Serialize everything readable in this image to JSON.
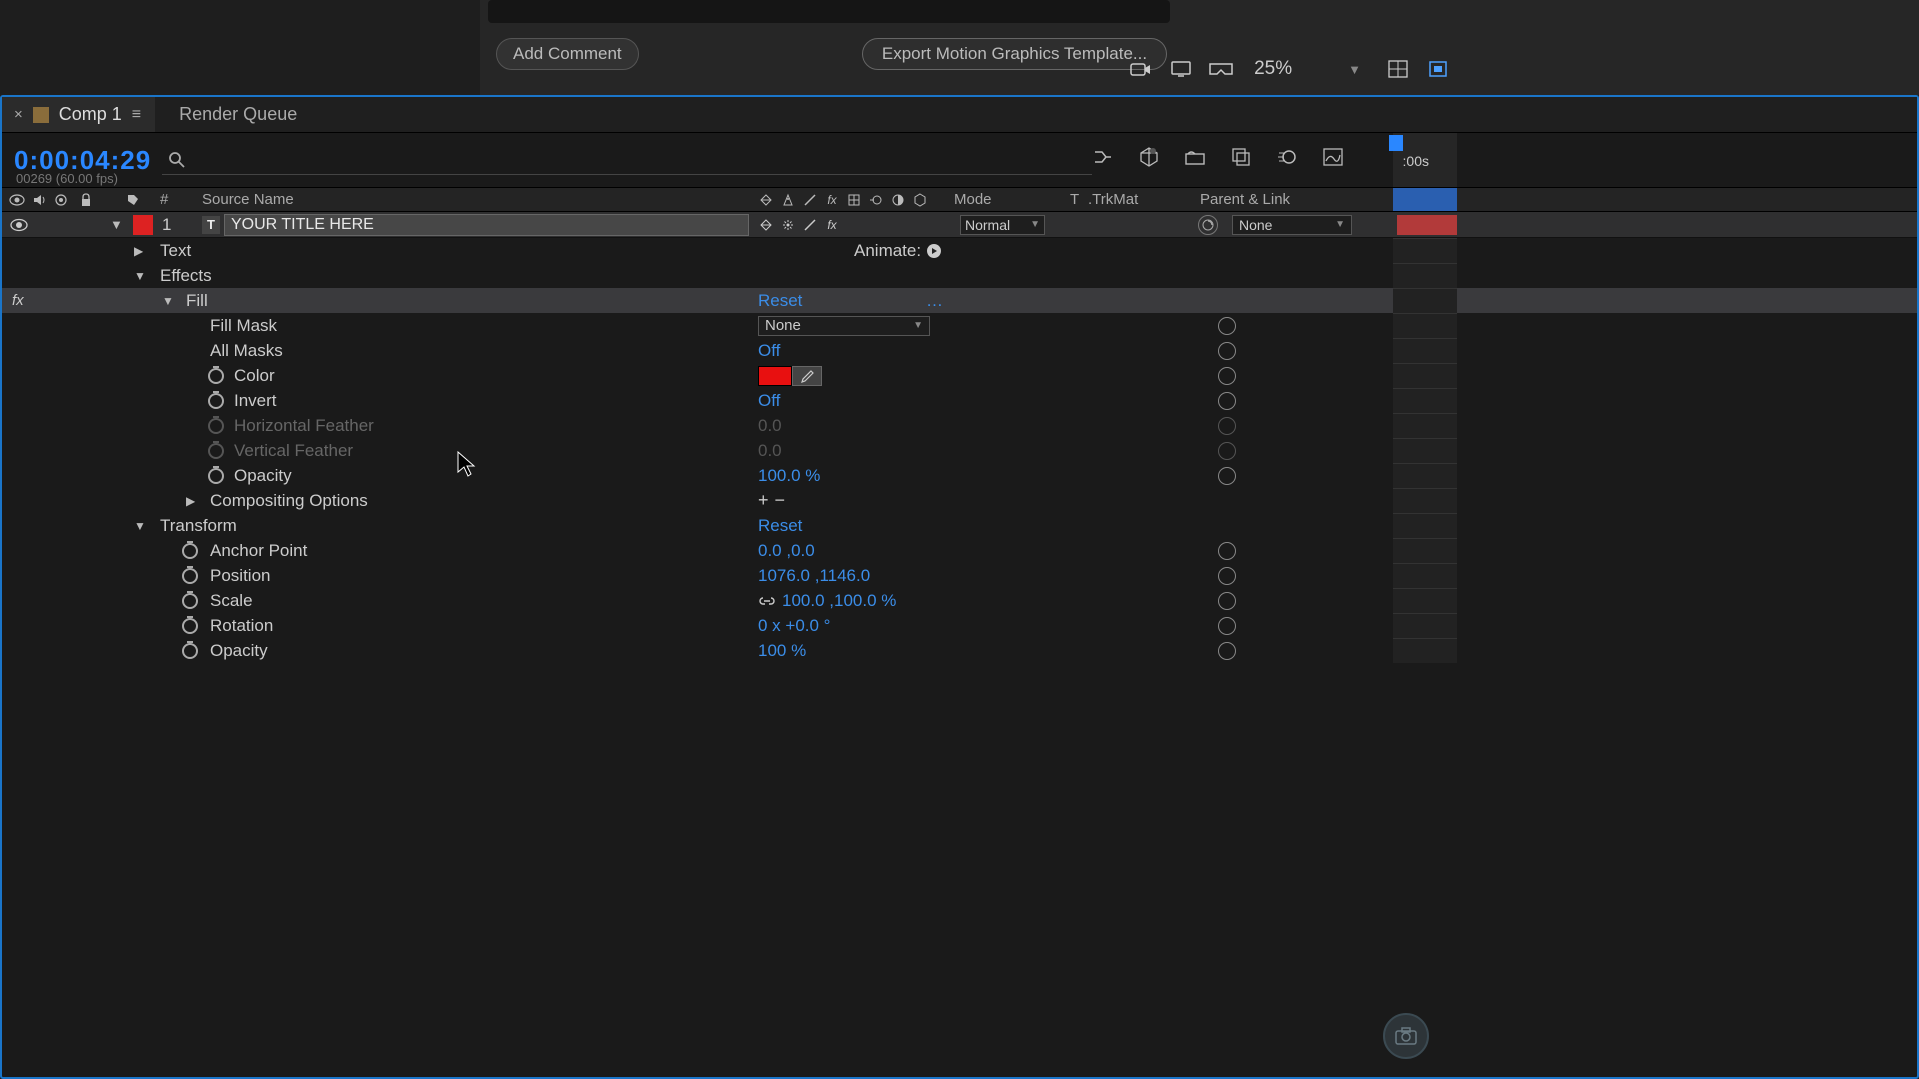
{
  "top": {
    "add_comment": "Add Comment",
    "export_btn": "Export Motion Graphics Template...",
    "zoom": "25%"
  },
  "tabs": {
    "comp_name": "Comp 1",
    "render_queue": "Render Queue"
  },
  "time": {
    "timecode": "0:00:04:29",
    "sub": "00269 (60.00 fps)",
    "ruler_start": ":00s"
  },
  "headers": {
    "num": "#",
    "source": "Source Name",
    "mode": "Mode",
    "t": "T",
    "trkmat": ".TrkMat",
    "parent": "Parent & Link"
  },
  "layer": {
    "index": "1",
    "type_letter": "T",
    "name": "YOUR TITLE HERE",
    "mode": "Normal",
    "parent": "None"
  },
  "text_group": {
    "label": "Text",
    "animate": "Animate:"
  },
  "effects": {
    "label": "Effects",
    "fill": {
      "label": "Fill",
      "reset": "Reset",
      "fill_mask_label": "Fill Mask",
      "fill_mask_value": "None",
      "all_masks_label": "All Masks",
      "all_masks_value": "Off",
      "color_label": "Color",
      "color_value": "#e81010",
      "invert_label": "Invert",
      "invert_value": "Off",
      "hfeather_label": "Horizontal Feather",
      "hfeather_value": "0.0",
      "vfeather_label": "Vertical Feather",
      "vfeather_value": "0.0",
      "opacity_label": "Opacity",
      "opacity_value": "100.0 %",
      "comp_opts_label": "Compositing Options"
    }
  },
  "transform": {
    "label": "Transform",
    "reset": "Reset",
    "anchor_label": "Anchor Point",
    "anchor_value": "0.0 ,0.0",
    "position_label": "Position",
    "position_value": "1076.0 ,1146.0",
    "scale_label": "Scale",
    "scale_value": "100.0 ,100.0 %",
    "rotation_label": "Rotation",
    "rotation_value": "0 x +0.0 °",
    "opacity_label": "Opacity",
    "opacity_value": "100 %"
  }
}
